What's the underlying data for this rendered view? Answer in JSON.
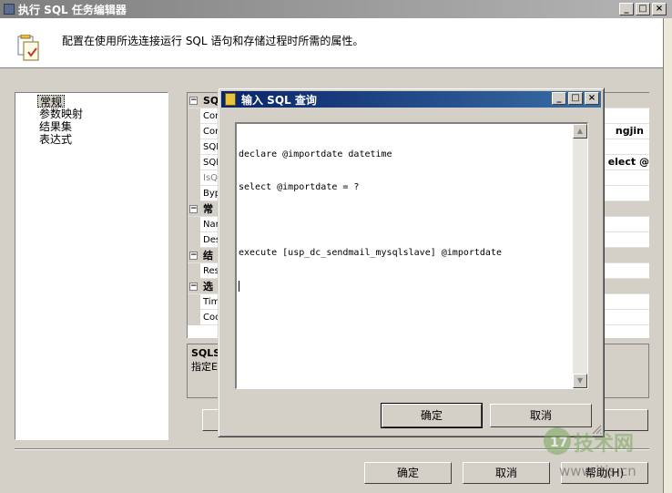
{
  "main_window": {
    "title": "执行 SQL 任务编辑器",
    "header_description": "配置在使用所选连接运行 SQL 语句和存储过程时所需的属性。",
    "nav_items": [
      "常规",
      "参数映射",
      "结果集",
      "表达式"
    ],
    "prop_rows": [
      {
        "kind": "cat",
        "label": "SQL"
      },
      {
        "kind": "prop",
        "label": "Con"
      },
      {
        "kind": "prop",
        "label": "Con"
      },
      {
        "kind": "prop",
        "label": "SQL"
      },
      {
        "kind": "prop",
        "label": "SQL"
      },
      {
        "kind": "prop",
        "label": "IsQ",
        "grey": true
      },
      {
        "kind": "prop",
        "label": "Byp"
      },
      {
        "kind": "cat",
        "label": "常"
      },
      {
        "kind": "prop",
        "label": "Nam"
      },
      {
        "kind": "prop",
        "label": "Des"
      },
      {
        "kind": "cat",
        "label": "结"
      },
      {
        "kind": "prop",
        "label": "Res"
      },
      {
        "kind": "cat",
        "label": "选"
      },
      {
        "kind": "prop",
        "label": "Tim"
      },
      {
        "kind": "prop",
        "label": "Coo"
      }
    ],
    "visible_values": {
      "connection_value": "ngjin",
      "sql_value": "elect @"
    },
    "description_panel": {
      "title": "SQLS",
      "text": "指定E"
    },
    "buttons": {
      "ok": "确定",
      "cancel": "取消",
      "help": "帮助(H)"
    }
  },
  "dialog": {
    "title": "输入 SQL 查询",
    "sql_lines": [
      "declare @importdate datetime",
      "select @importdate = ?",
      "",
      "execute [usp_dc_sendmail_mysqlslave] @importdate"
    ],
    "buttons": {
      "ok": "确定",
      "cancel": "取消"
    }
  },
  "window_controls": {
    "minimize": "_",
    "maximize": "□",
    "close": "×"
  },
  "watermark": {
    "brand": "17技术网",
    "url": "www.itjs.cn"
  },
  "colors": {
    "dialog_title_start": "#0a246a",
    "dialog_title_end": "#3a6ea5",
    "inactive_title_start": "#7f7f7f",
    "face": "#d4d0c8"
  }
}
